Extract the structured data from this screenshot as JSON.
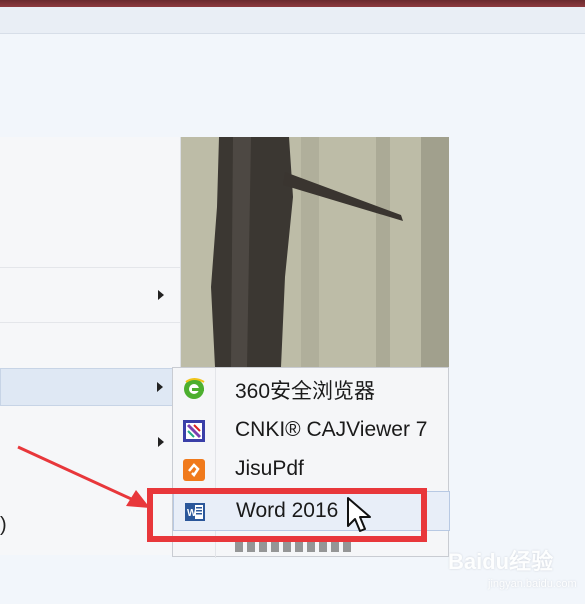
{
  "submenu": {
    "items": [
      {
        "label": "360安全浏览器",
        "icon": "browser-360-icon"
      },
      {
        "label": "CNKI® CAJViewer 7",
        "icon": "cajviewer-icon"
      },
      {
        "label": "JisuPdf",
        "icon": "jisupdf-icon"
      },
      {
        "label": "Word 2016",
        "icon": "word-icon"
      }
    ]
  },
  "left_menu": {
    "truncated_text": ")"
  },
  "watermark": {
    "brand": "Baidu经验",
    "url": "jingyan.baidu.com"
  },
  "colors": {
    "annotation_red": "#e8373b",
    "highlight": "#e8eef8"
  }
}
